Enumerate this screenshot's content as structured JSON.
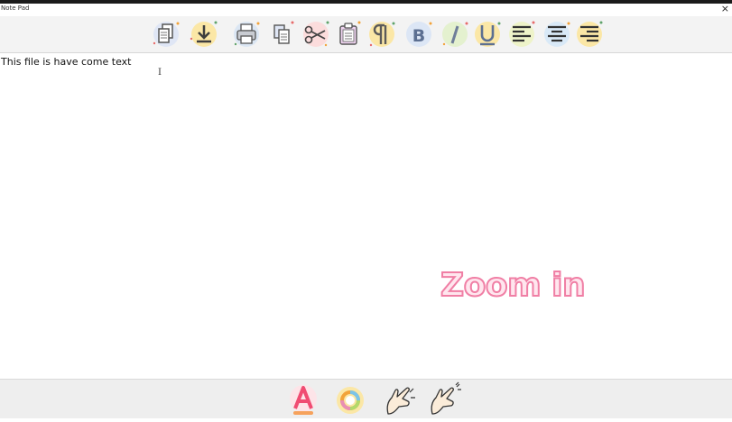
{
  "window": {
    "title": "Note Pad",
    "close_glyph": "×"
  },
  "toolbar": {
    "items": [
      {
        "name": "copy-file-button",
        "icon": "copy-document-icon",
        "bubble": "#dfe6f5"
      },
      {
        "name": "download-button",
        "icon": "download-icon",
        "bubble": "#fbe7a6"
      },
      {
        "name": "print-button",
        "icon": "printer-icon",
        "bubble": "#dbe6f3"
      },
      {
        "name": "copy-button",
        "icon": "copy-icon",
        "bubble": "#f3f3f3"
      },
      {
        "name": "cut-button",
        "icon": "scissors-icon",
        "bubble": "#fbdcdc"
      },
      {
        "name": "paste-button",
        "icon": "clipboard-icon",
        "bubble": "#f3f3f3"
      },
      {
        "name": "paragraph-button",
        "icon": "pilcrow-icon",
        "bubble": "#fbe7a6"
      },
      {
        "name": "bold-button",
        "icon": "bold-icon",
        "bubble": "#dce6f5"
      },
      {
        "name": "italic-button",
        "icon": "italic-icon",
        "bubble": "#e4f1cf"
      },
      {
        "name": "underline-button",
        "icon": "underline-icon",
        "bubble": "#fbe7a6"
      },
      {
        "name": "align-left-button",
        "icon": "align-left-icon",
        "bubble": "#eef3c9"
      },
      {
        "name": "align-center-button",
        "icon": "align-center-icon",
        "bubble": "#d9e9f7"
      },
      {
        "name": "align-right-button",
        "icon": "align-right-icon",
        "bubble": "#fbe7a6"
      }
    ]
  },
  "editor": {
    "content": "This file is have come text",
    "cursor_glyph": "I"
  },
  "overlay": {
    "zoom_text": "Zoom in"
  },
  "bottom_toolbar": {
    "items": [
      {
        "name": "font-color-button",
        "icon": "font-color-icon"
      },
      {
        "name": "color-wheel-button",
        "icon": "color-wheel-icon"
      },
      {
        "name": "zoom-out-button",
        "icon": "pinch-zoom-out-icon"
      },
      {
        "name": "zoom-in-button",
        "icon": "pinch-zoom-in-icon"
      }
    ]
  }
}
